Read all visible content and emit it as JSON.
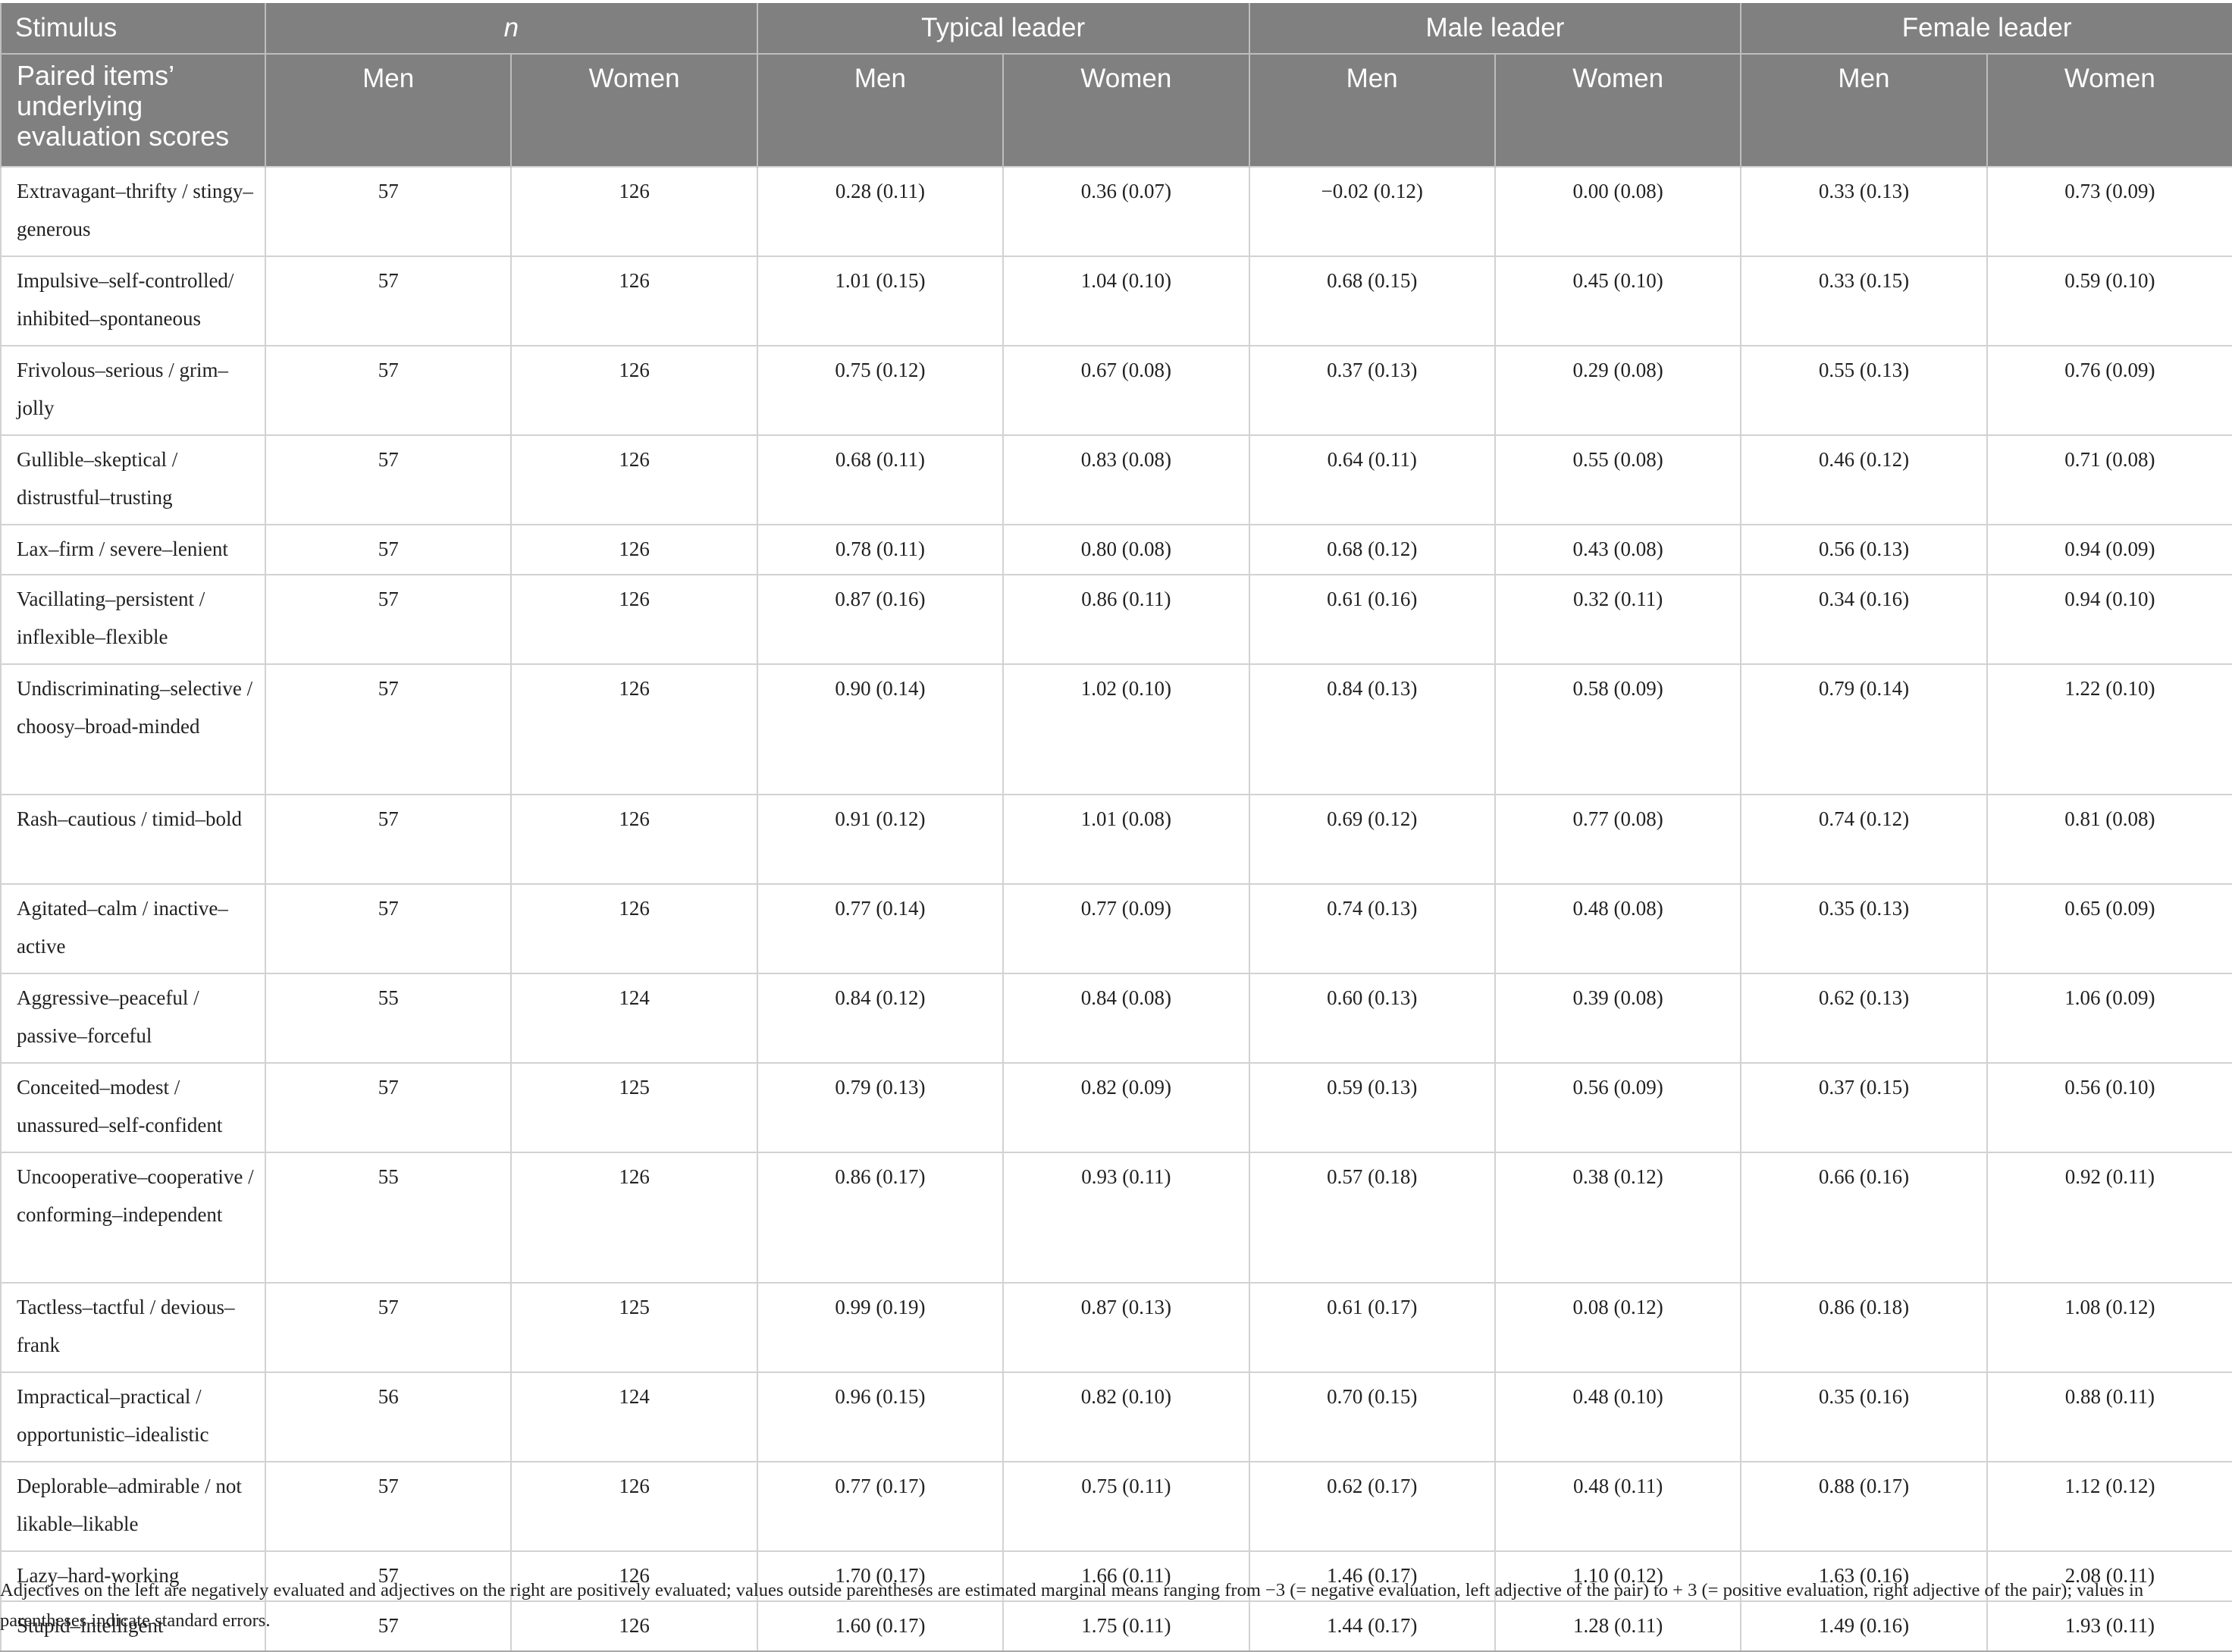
{
  "table": {
    "header": {
      "stimulus": "Stimulus",
      "n": "n",
      "typical_leader": "Typical leader",
      "male_leader": "Male leader",
      "female_leader": "Female leader",
      "paired_items": "Paired items’ underlying evaluation scores",
      "men": "Men",
      "women": "Women"
    },
    "rows": [
      {
        "item": "Extravagant–thrifty / stingy–generous",
        "n_men": "57",
        "n_women": "126",
        "typical_men": "0.28 (0.11)",
        "typical_women": "0.36 (0.07)",
        "male_men": "−0.02 (0.12)",
        "male_women": "0.00 (0.08)",
        "female_men": "0.33 (0.13)",
        "female_women": "0.73 (0.09)"
      },
      {
        "item": "Impulsive–self-controlled/ inhibited–spontaneous",
        "n_men": "57",
        "n_women": "126",
        "typical_men": "1.01 (0.15)",
        "typical_women": "1.04 (0.10)",
        "male_men": "0.68 (0.15)",
        "male_women": "0.45 (0.10)",
        "female_men": "0.33 (0.15)",
        "female_women": "0.59 (0.10)"
      },
      {
        "item": "Frivolous–serious / grim–jolly",
        "n_men": "57",
        "n_women": "126",
        "typical_men": "0.75 (0.12)",
        "typical_women": "0.67 (0.08)",
        "male_men": "0.37 (0.13)",
        "male_women": "0.29 (0.08)",
        "female_men": "0.55 (0.13)",
        "female_women": "0.76 (0.09)"
      },
      {
        "item": "Gullible–skeptical / distrustful–trusting",
        "n_men": "57",
        "n_women": "126",
        "typical_men": "0.68 (0.11)",
        "typical_women": "0.83 (0.08)",
        "male_men": "0.64 (0.11)",
        "male_women": "0.55 (0.08)",
        "female_men": "0.46 (0.12)",
        "female_women": "0.71 (0.08)"
      },
      {
        "item": "Lax–firm / severe–lenient",
        "n_men": "57",
        "n_women": "126",
        "typical_men": "0.78 (0.11)",
        "typical_women": "0.80 (0.08)",
        "male_men": "0.68 (0.12)",
        "male_women": "0.43 (0.08)",
        "female_men": "0.56 (0.13)",
        "female_women": "0.94 (0.09)"
      },
      {
        "item": "Vacillating–persistent / inflexible–flexible",
        "n_men": "57",
        "n_women": "126",
        "typical_men": "0.87 (0.16)",
        "typical_women": "0.86 (0.11)",
        "male_men": "0.61 (0.16)",
        "male_women": "0.32 (0.11)",
        "female_men": "0.34 (0.16)",
        "female_women": "0.94 (0.10)"
      },
      {
        "item": "Undiscriminating–selective / choosy–broad-minded",
        "n_men": "57",
        "n_women": "126",
        "typical_men": "0.90 (0.14)",
        "typical_women": "1.02 (0.10)",
        "male_men": "0.84 (0.13)",
        "male_women": "0.58 (0.09)",
        "female_men": "0.79 (0.14)",
        "female_women": "1.22 (0.10)"
      },
      {
        "item": "Rash–cautious / timid–bold",
        "n_men": "57",
        "n_women": "126",
        "typical_men": "0.91 (0.12)",
        "typical_women": "1.01 (0.08)",
        "male_men": "0.69 (0.12)",
        "male_women": "0.77 (0.08)",
        "female_men": "0.74 (0.12)",
        "female_women": "0.81 (0.08)"
      },
      {
        "item": "Agitated–calm / inactive–active",
        "n_men": "57",
        "n_women": "126",
        "typical_men": "0.77 (0.14)",
        "typical_women": "0.77 (0.09)",
        "male_men": "0.74 (0.13)",
        "male_women": "0.48 (0.08)",
        "female_men": "0.35 (0.13)",
        "female_women": "0.65 (0.09)"
      },
      {
        "item": "Aggressive–peaceful / passive–forceful",
        "n_men": "55",
        "n_women": "124",
        "typical_men": "0.84 (0.12)",
        "typical_women": "0.84 (0.08)",
        "male_men": "0.60 (0.13)",
        "male_women": "0.39 (0.08)",
        "female_men": "0.62 (0.13)",
        "female_women": "1.06 (0.09)"
      },
      {
        "item": "Conceited–modest / unassured–self-confident",
        "n_men": "57",
        "n_women": "125",
        "typical_men": "0.79 (0.13)",
        "typical_women": "0.82 (0.09)",
        "male_men": "0.59 (0.13)",
        "male_women": "0.56 (0.09)",
        "female_men": "0.37 (0.15)",
        "female_women": "0.56 (0.10)"
      },
      {
        "item": "Uncooperative–cooperative / conforming–independent",
        "n_men": "55",
        "n_women": "126",
        "typical_men": "0.86 (0.17)",
        "typical_women": "0.93 (0.11)",
        "male_men": "0.57 (0.18)",
        "male_women": "0.38 (0.12)",
        "female_men": "0.66 (0.16)",
        "female_women": "0.92 (0.11)"
      },
      {
        "item": "Tactless–tactful / devious–frank",
        "n_men": "57",
        "n_women": "125",
        "typical_men": "0.99 (0.19)",
        "typical_women": "0.87 (0.13)",
        "male_men": "0.61 (0.17)",
        "male_women": "0.08 (0.12)",
        "female_men": "0.86 (0.18)",
        "female_women": "1.08 (0.12)"
      },
      {
        "item": "Impractical–practical / opportunistic–idealistic",
        "n_men": "56",
        "n_women": "124",
        "typical_men": "0.96 (0.15)",
        "typical_women": "0.82 (0.10)",
        "male_men": "0.70 (0.15)",
        "male_women": "0.48 (0.10)",
        "female_men": "0.35 (0.16)",
        "female_women": "0.88 (0.11)"
      },
      {
        "item": "Deplorable–admirable / not likable–likable",
        "n_men": "57",
        "n_women": "126",
        "typical_men": "0.77 (0.17)",
        "typical_women": "0.75 (0.11)",
        "male_men": "0.62 (0.17)",
        "male_women": "0.48 (0.11)",
        "female_men": "0.88 (0.17)",
        "female_women": "1.12 (0.12)"
      },
      {
        "item": "Lazy–hard-working",
        "n_men": "57",
        "n_women": "126",
        "typical_men": "1.70 (0.17)",
        "typical_women": "1.66 (0.11)",
        "male_men": "1.46 (0.17)",
        "male_women": "1.10 (0.12)",
        "female_men": "1.63 (0.16)",
        "female_women": "2.08 (0.11)"
      },
      {
        "item": "Stupid–intelligent",
        "n_men": "57",
        "n_women": "126",
        "typical_men": "1.60 (0.17)",
        "typical_women": "1.75 (0.11)",
        "male_men": "1.44 (0.17)",
        "male_women": "1.28 (0.11)",
        "female_men": "1.49 (0.16)",
        "female_women": "1.93 (0.11)"
      }
    ],
    "note": "Adjectives on the left are negatively evaluated and adjectives on the right are positively evaluated; values outside parentheses are estimated marginal means ranging from −3 (= negative evaluation, left adjective of the pair) to + 3 (= positive evaluation, right adjective of the pair); values in parentheses indicate standard errors."
  }
}
